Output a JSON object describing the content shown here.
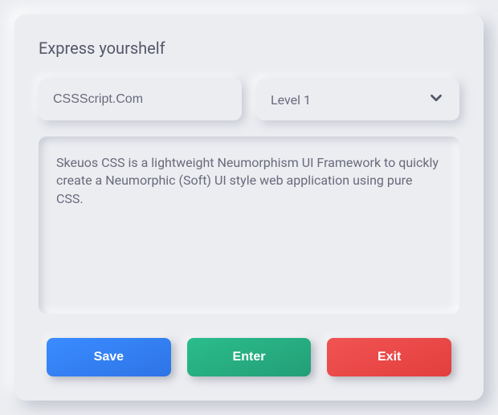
{
  "form": {
    "title": "Express yourshelf",
    "name_input": {
      "value": "CSSScript.Com"
    },
    "level_select": {
      "selected": "Level 1"
    },
    "textarea": {
      "value": "Skeuos CSS is a lightweight Neumorphism UI Framework to quickly create a Neumorphic (Soft) UI style web application using pure CSS."
    }
  },
  "buttons": {
    "save": "Save",
    "enter": "Enter",
    "exit": "Exit"
  },
  "icons": {
    "chevron_down": "chevron-down"
  }
}
